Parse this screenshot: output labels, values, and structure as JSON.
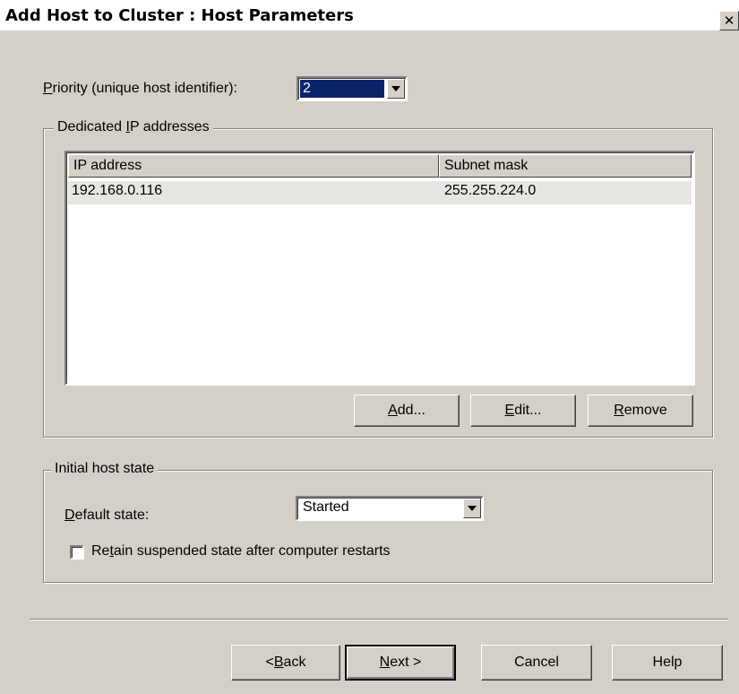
{
  "window": {
    "title": "Add Host to Cluster : Host Parameters",
    "close_glyph": "✕"
  },
  "priority": {
    "label_mnemonic": "P",
    "label_rest": "riority (unique host identifier):",
    "value": "2"
  },
  "dedicated_ip": {
    "title_prefix": "Dedicated ",
    "title_mnemonic": "I",
    "title_rest": "P addresses",
    "columns": [
      "IP address",
      "Subnet mask"
    ],
    "rows": [
      {
        "ip": "192.168.0.116",
        "mask": "255.255.224.0"
      }
    ],
    "buttons": {
      "add": {
        "mnemonic": "A",
        "rest": "dd..."
      },
      "edit": {
        "mnemonic": "E",
        "rest": "dit..."
      },
      "remove": {
        "mnemonic": "R",
        "rest": "emove"
      }
    }
  },
  "initial_state": {
    "title": "Initial host state",
    "default_state_mnemonic": "D",
    "default_state_rest": "efault state:",
    "default_state_value": "Started",
    "retain_prefix": "Re",
    "retain_mnemonic": "t",
    "retain_rest": "ain suspended state after computer restarts",
    "retain_checked": false
  },
  "footer": {
    "back_prefix": "< ",
    "back_mnemonic": "B",
    "back_rest": "ack",
    "next_mnemonic": "N",
    "next_rest": "ext >",
    "cancel": "Cancel",
    "help": "Help"
  }
}
